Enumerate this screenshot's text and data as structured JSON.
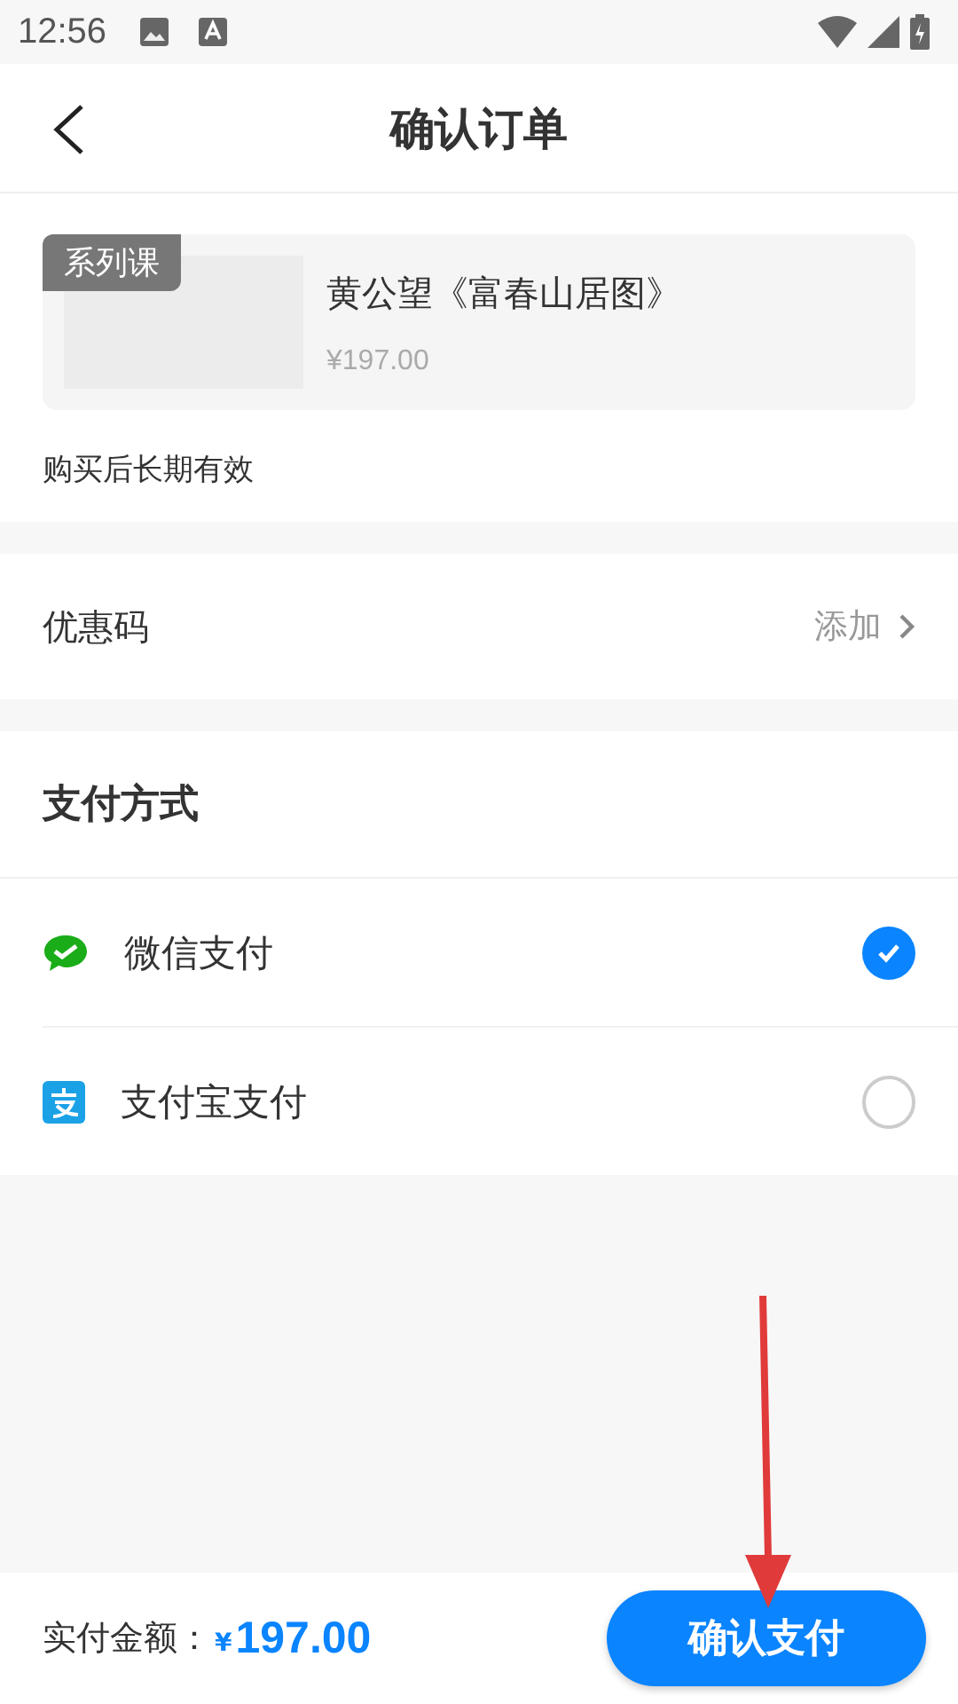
{
  "status_bar": {
    "time": "12:56"
  },
  "header": {
    "title": "确认订单"
  },
  "product": {
    "tag": "系列课",
    "title": "黄公望《富春山居图》",
    "price": "¥197.00",
    "validity": "购买后长期有效"
  },
  "coupon": {
    "label": "优惠码",
    "action": "添加"
  },
  "payment": {
    "title": "支付方式",
    "methods": [
      {
        "kind": "wechat",
        "label": "微信支付",
        "selected": true
      },
      {
        "kind": "alipay",
        "label": "支付宝支付",
        "selected": false
      }
    ]
  },
  "footer": {
    "label": "实付金额：",
    "currency": "¥",
    "amount": "197.00",
    "button": "确认支付"
  }
}
